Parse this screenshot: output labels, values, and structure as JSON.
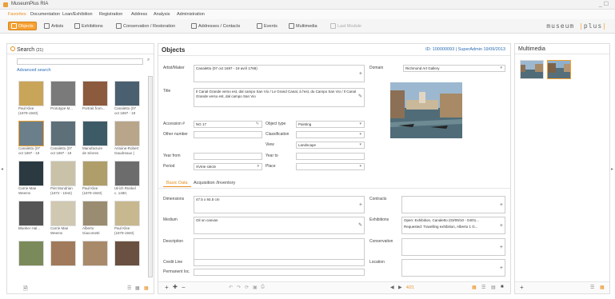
{
  "window": {
    "title": "MuseumPlus RIA",
    "control": "_ ☐"
  },
  "menu": [
    "Favorites",
    "Documentation",
    "Loan/Exhibition",
    "Registration",
    "Address",
    "Analysis",
    "Administration"
  ],
  "toolbar": {
    "items": [
      "Objects",
      "Artists",
      "Exhibitions",
      "Conservation / Restoration",
      "Addresses / Contacts",
      "Events",
      "Multimedia",
      "Last Module"
    ],
    "brand_left": "museum",
    "brand_right": "plus"
  },
  "search": {
    "title": "Search",
    "count": "(21)",
    "advanced": "Advanced search",
    "results": [
      {
        "c1": "Paul Klee",
        "c2": "(1879-1940)"
      },
      {
        "c1": "Prototype M...",
        "c2": ""
      },
      {
        "c1": "Portrait from...",
        "c2": ""
      },
      {
        "c1": "Canaletto (07",
        "c2": "oct 1697 - 19"
      },
      {
        "c1": "Canaletto (07",
        "c2": "oct 1697 - 19"
      },
      {
        "c1": "Canaletto (07",
        "c2": "oct 1697 - 19"
      },
      {
        "c1": "Manufacture",
        "c2": "de Sèvres"
      },
      {
        "c1": "Antoine-Robert",
        "c2": "Gaudreaux ("
      },
      {
        "c1": "Carrie Mae",
        "c2": "Weems"
      },
      {
        "c1": "Piet Mondrian",
        "c2": "(1872 - 1944)"
      },
      {
        "c1": "Paul Klee",
        "c2": "(1879-1940)"
      },
      {
        "c1": "Ulrich Rünkel",
        "c2": "c. 1480,"
      },
      {
        "c1": "Blanker Hal...",
        "c2": ""
      },
      {
        "c1": "Carrie Mae",
        "c2": "Weems"
      },
      {
        "c1": "Alberto",
        "c2": "Giacometti"
      },
      {
        "c1": "Paul Klee",
        "c2": "(1879-1940)"
      },
      {
        "c1": "",
        "c2": ""
      },
      {
        "c1": "",
        "c2": ""
      },
      {
        "c1": "",
        "c2": ""
      },
      {
        "c1": "",
        "c2": ""
      }
    ]
  },
  "objects": {
    "title": "Objects",
    "id_info": "ID: 100000093 | SuperAdmin 19/09/2013",
    "artist_label": "Artist/Maker",
    "artist_value": "Canaletto (07 oct 1697 - 19 avril 1768)",
    "domain_label": "Domain",
    "domain_value": "Richmond Art Gallery",
    "title_label": "Title",
    "title_value": "Il Canal Grande verso est, dal campo San Vio / Le Grand Canal, à l'est, du Campo San Vio / Il Canal Grande verso est, dal campo San Vio",
    "accession_label": "Accession #",
    "accession_value": "NG 17",
    "object_type_label": "Object type",
    "object_type_value": "Painting",
    "other_number_label": "Other number",
    "classification_label": "Classification",
    "view_label": "View",
    "view_value": "Landscape",
    "year_from_label": "Year from",
    "year_to_label": "Year to",
    "period_label": "Period",
    "period_value": "XVIIIe siècle",
    "place_label": "Place",
    "tabs": [
      "Basic Data",
      "Acquisition /Inventory"
    ],
    "dimensions_label": "Dimensions",
    "dimensions_value": "47.5 x 84.5 cm",
    "medium_label": "Medium",
    "medium_value": "Oil on canvas",
    "description_label": "Description",
    "credit_label": "Credit Line",
    "permanent_label": "Permanent loc.",
    "contracts_label": "Contracts",
    "exhibitions_label": "Exhibitions",
    "exhibition_1": "Open: Exhibition, Canaletto (03/09/10 - 04/01...",
    "exhibition_2": "Requested: Travelling exhibition, Alberto 1 G...",
    "conservation_label": "Conservation",
    "location_label": "Location",
    "pager": "4/21"
  },
  "multimedia": {
    "title": "Multimedia"
  }
}
